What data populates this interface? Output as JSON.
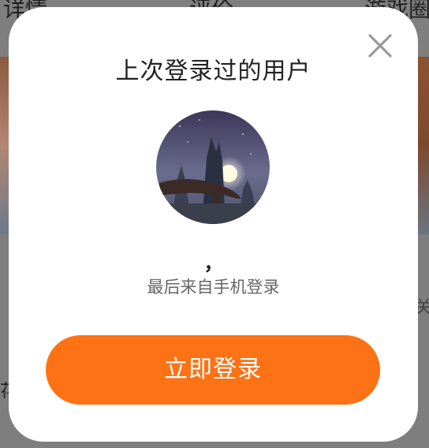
{
  "background": {
    "tabs": [
      "详情",
      "评价",
      "游戏圈"
    ],
    "side_text_left": "花",
    "side_text_right": "关"
  },
  "dialog": {
    "title": "上次登录过的用户",
    "close_icon": "close-icon",
    "avatar_icon": "avatar-image",
    "username": "，",
    "last_login_text": "最后来自手机登录",
    "login_button_label": "立即登录",
    "accent_color": "#fe7216"
  }
}
